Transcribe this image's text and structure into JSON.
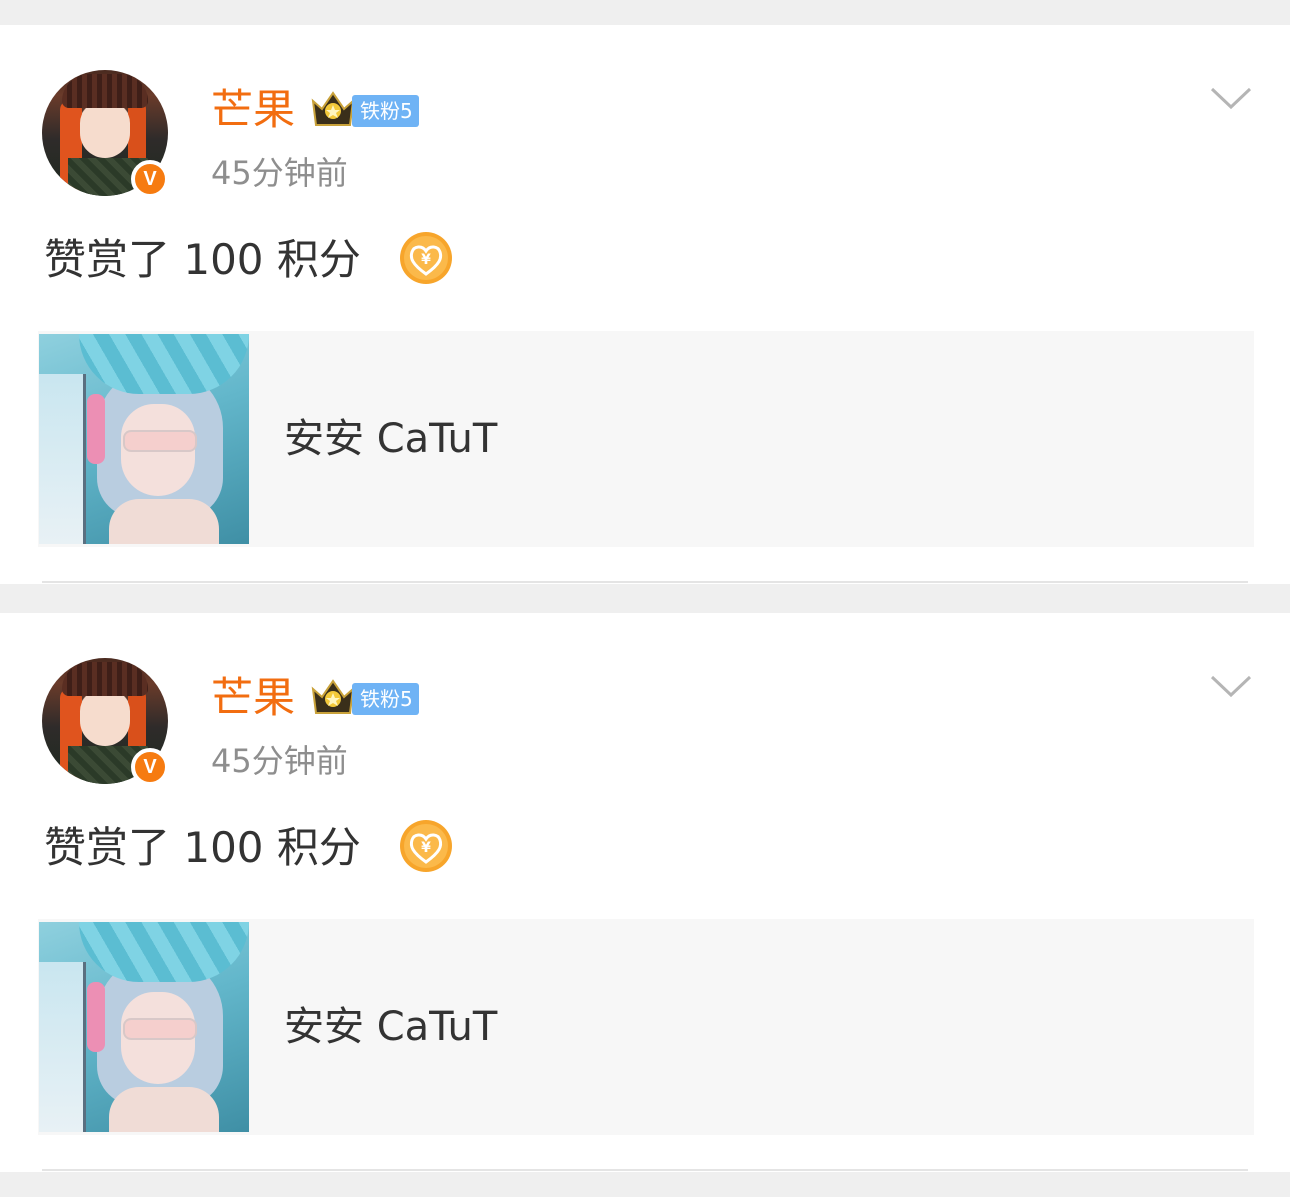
{
  "feed": {
    "posts": [
      {
        "user": {
          "name": "芒果",
          "verified_badge": "V",
          "crown_icon": "crown-icon",
          "fan_badge": "铁粉5",
          "name_color": "#f26d10"
        },
        "timestamp": "45分钟前",
        "text": "赞赏了 100 积分",
        "reward_icon": "yuan-heart-coin-icon",
        "card": {
          "title": "安安 CaTuT"
        },
        "menu_icon": "chevron-down-icon"
      },
      {
        "user": {
          "name": "芒果",
          "verified_badge": "V",
          "crown_icon": "crown-icon",
          "fan_badge": "铁粉5",
          "name_color": "#f26d10"
        },
        "timestamp": "45分钟前",
        "text": "赞赏了 100 积分",
        "reward_icon": "yuan-heart-coin-icon",
        "card": {
          "title": "安安 CaTuT"
        },
        "menu_icon": "chevron-down-icon"
      }
    ]
  },
  "colors": {
    "accent_orange": "#f26d10",
    "fan_badge_blue": "#6fb3f5",
    "verify_orange": "#f67b10",
    "background_gray": "#efefef",
    "card_gray": "#f7f7f7"
  }
}
